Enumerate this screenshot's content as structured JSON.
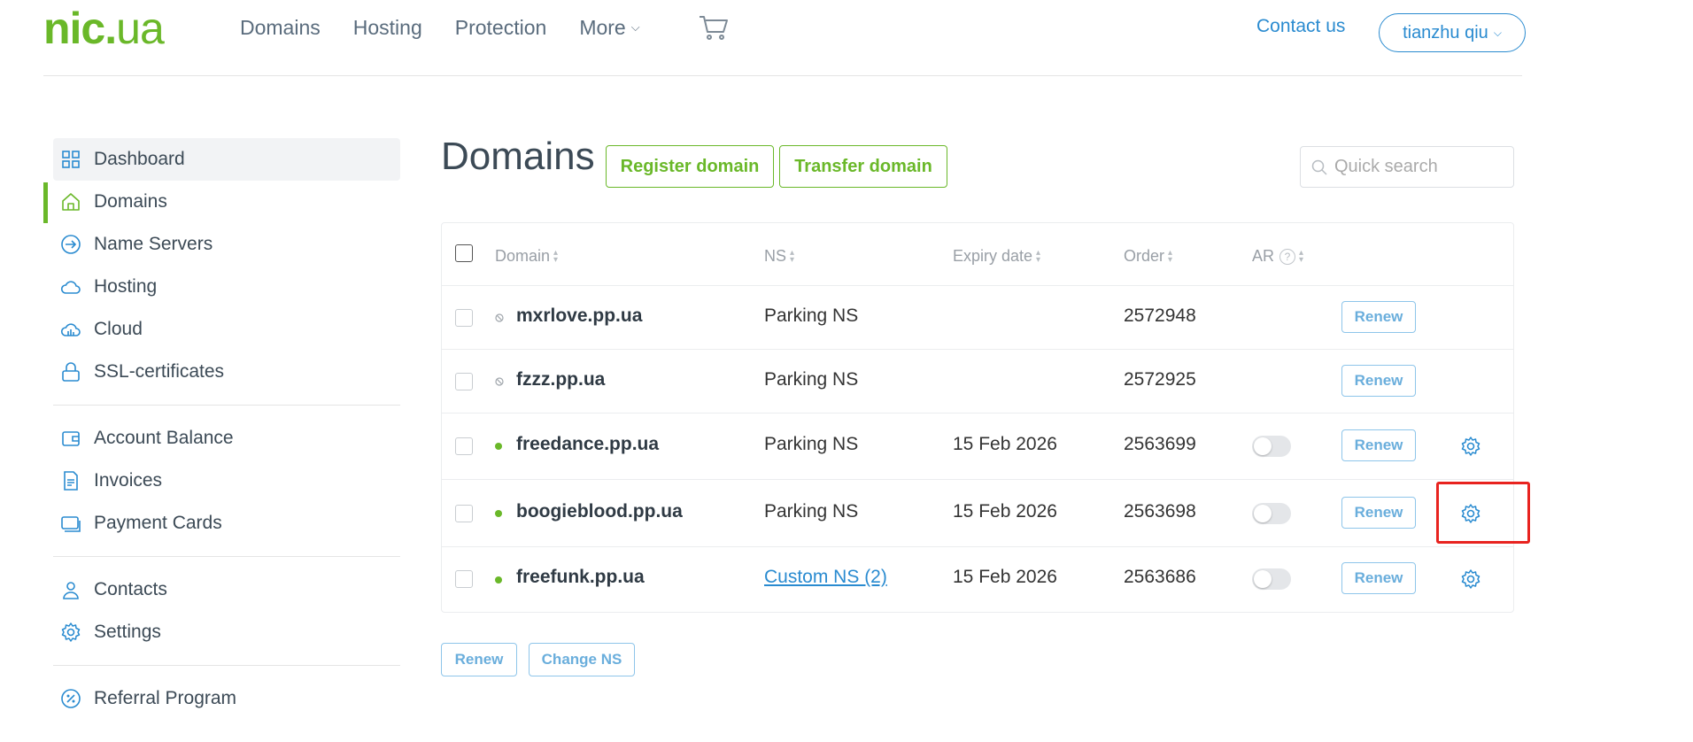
{
  "header": {
    "logo": {
      "part1": "nic",
      "dot": ".",
      "part2": "ua"
    },
    "nav": [
      {
        "label": "Domains"
      },
      {
        "label": "Hosting"
      },
      {
        "label": "Protection"
      },
      {
        "label": "More"
      }
    ],
    "contact_label": "Contact us",
    "user_label": "tianzhu qiu"
  },
  "sidebar": {
    "groups": [
      [
        {
          "label": "Dashboard",
          "icon": "dashboard-icon"
        },
        {
          "label": "Domains",
          "icon": "home-icon"
        },
        {
          "label": "Name Servers",
          "icon": "arrow-circle-icon"
        },
        {
          "label": "Hosting",
          "icon": "cloud-icon"
        },
        {
          "label": "Cloud",
          "icon": "cloud-server-icon"
        },
        {
          "label": "SSL-certificates",
          "icon": "lock-icon"
        }
      ],
      [
        {
          "label": "Account Balance",
          "icon": "wallet-icon"
        },
        {
          "label": "Invoices",
          "icon": "invoice-icon"
        },
        {
          "label": "Payment Cards",
          "icon": "card-icon"
        }
      ],
      [
        {
          "label": "Contacts",
          "icon": "user-icon"
        },
        {
          "label": "Settings",
          "icon": "gear-icon"
        }
      ],
      [
        {
          "label": "Referral Program",
          "icon": "percent-icon"
        }
      ]
    ]
  },
  "main": {
    "title": "Domains",
    "register_label": "Register domain",
    "transfer_label": "Transfer domain",
    "search_placeholder": "Quick search",
    "columns": {
      "domain": "Domain",
      "ns": "NS",
      "expiry": "Expiry date",
      "order": "Order",
      "ar": "AR",
      "ar_help": "?"
    },
    "rows": [
      {
        "name": "mxrlove.pp.ua",
        "ns": "Parking NS",
        "expiry": "",
        "order": "2572948",
        "status": "blocked"
      },
      {
        "name": "fzzz.pp.ua",
        "ns": "Parking NS",
        "expiry": "",
        "order": "2572925",
        "status": "blocked"
      },
      {
        "name": "freedance.pp.ua",
        "ns": "Parking NS",
        "expiry": "15 Feb 2026",
        "order": "2563699",
        "status": "active"
      },
      {
        "name": "boogieblood.pp.ua",
        "ns": "Parking NS",
        "expiry": "15 Feb 2026",
        "order": "2563698",
        "status": "active"
      },
      {
        "name": "freefunk.pp.ua",
        "ns": "Custom NS (2)",
        "expiry": "15 Feb 2026",
        "order": "2563686",
        "status": "active"
      }
    ],
    "renew_label": "Renew",
    "bulk_renew_label": "Renew",
    "change_ns_label": "Change NS"
  },
  "colors": {
    "brand_green": "#6ab829",
    "link_blue": "#2a8bd0",
    "highlight_red": "#e8231f"
  }
}
